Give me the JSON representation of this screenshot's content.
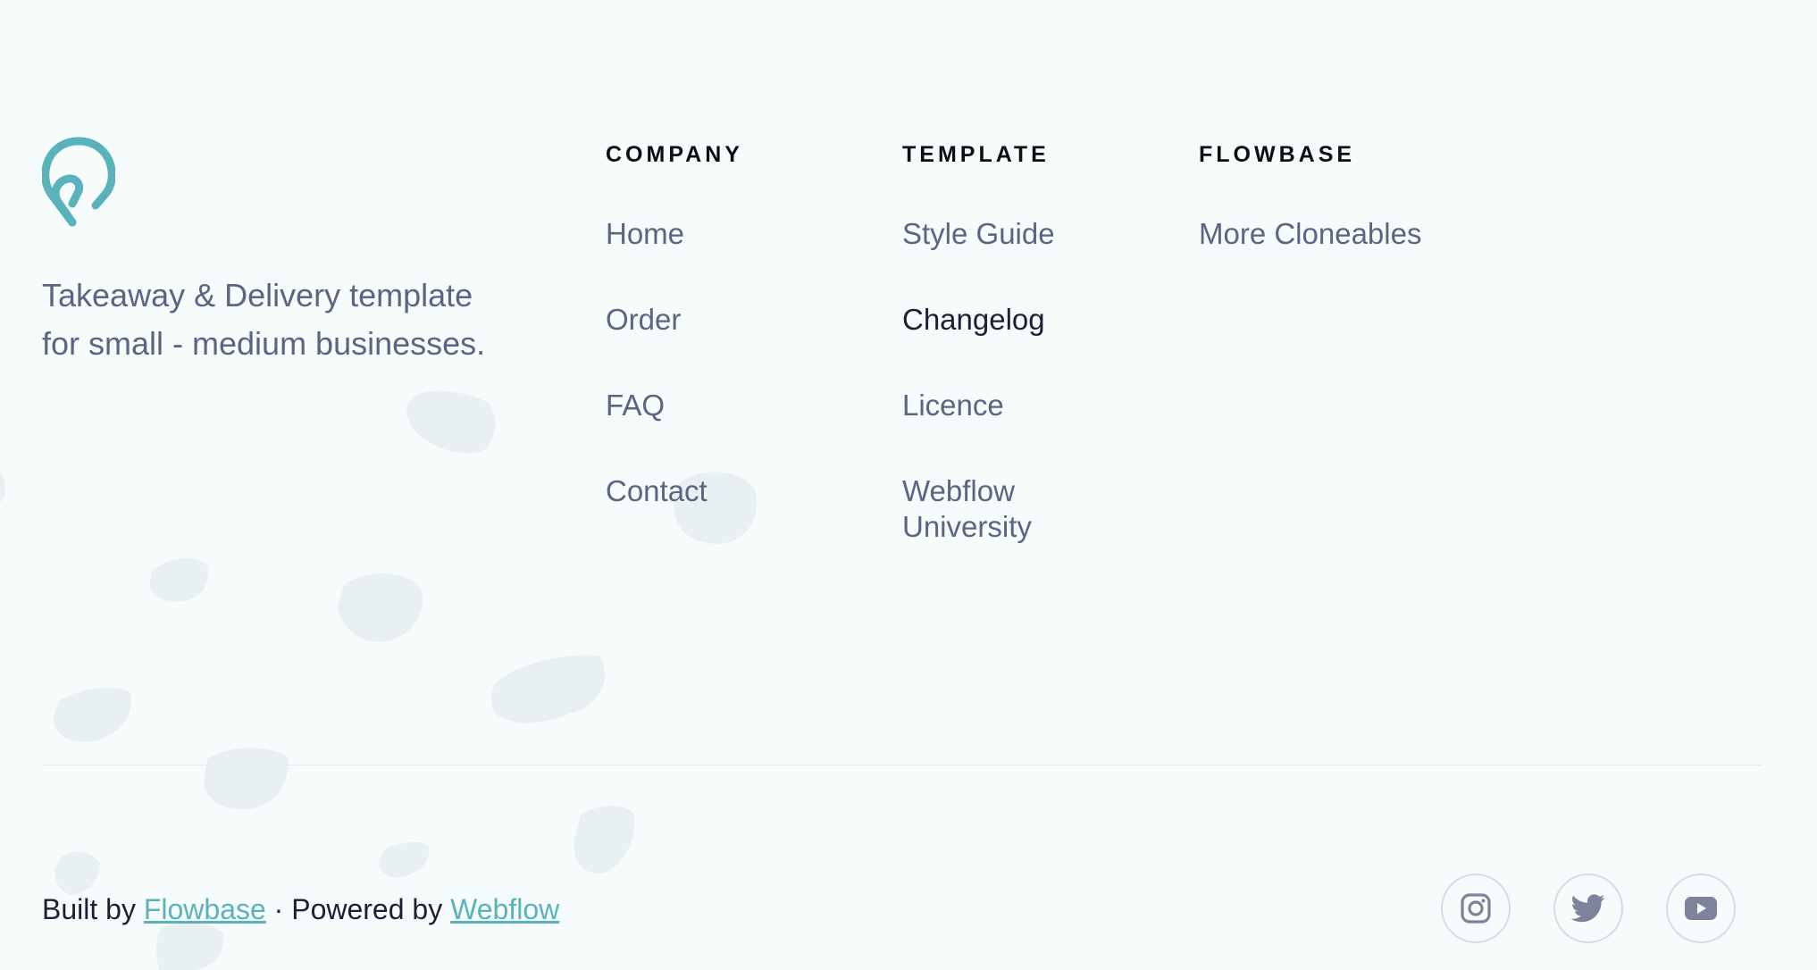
{
  "brand": {
    "tagline_line1": "Takeaway & Delivery template",
    "tagline_line2": "for small - medium businesses.",
    "logo_icon": "location-pin-logo-icon",
    "accent_color": "#5ab3bb"
  },
  "columns": {
    "company": {
      "heading": "COMPANY",
      "links": [
        "Home",
        "Order",
        "FAQ",
        "Contact"
      ]
    },
    "template": {
      "heading": "TEMPLATE",
      "links": [
        "Style Guide",
        "Changelog",
        "Licence",
        "Webflow University"
      ]
    },
    "flowbase": {
      "heading": "FLOWBASE",
      "links": [
        "More Cloneables"
      ]
    }
  },
  "credits": {
    "built_by_prefix": "Built by",
    "built_by_link": "Flowbase",
    "powered_by_prefix": "· Powered by",
    "powered_by_link": "Webflow"
  },
  "socials": [
    {
      "icon": "instagram-icon"
    },
    {
      "icon": "twitter-icon"
    },
    {
      "icon": "youtube-icon"
    }
  ],
  "colors": {
    "background": "#f6fbfb",
    "text_muted": "#5c6483",
    "text_dark": "#1d2035",
    "heading": "#0d0d12",
    "link": "#5ab3bb"
  }
}
